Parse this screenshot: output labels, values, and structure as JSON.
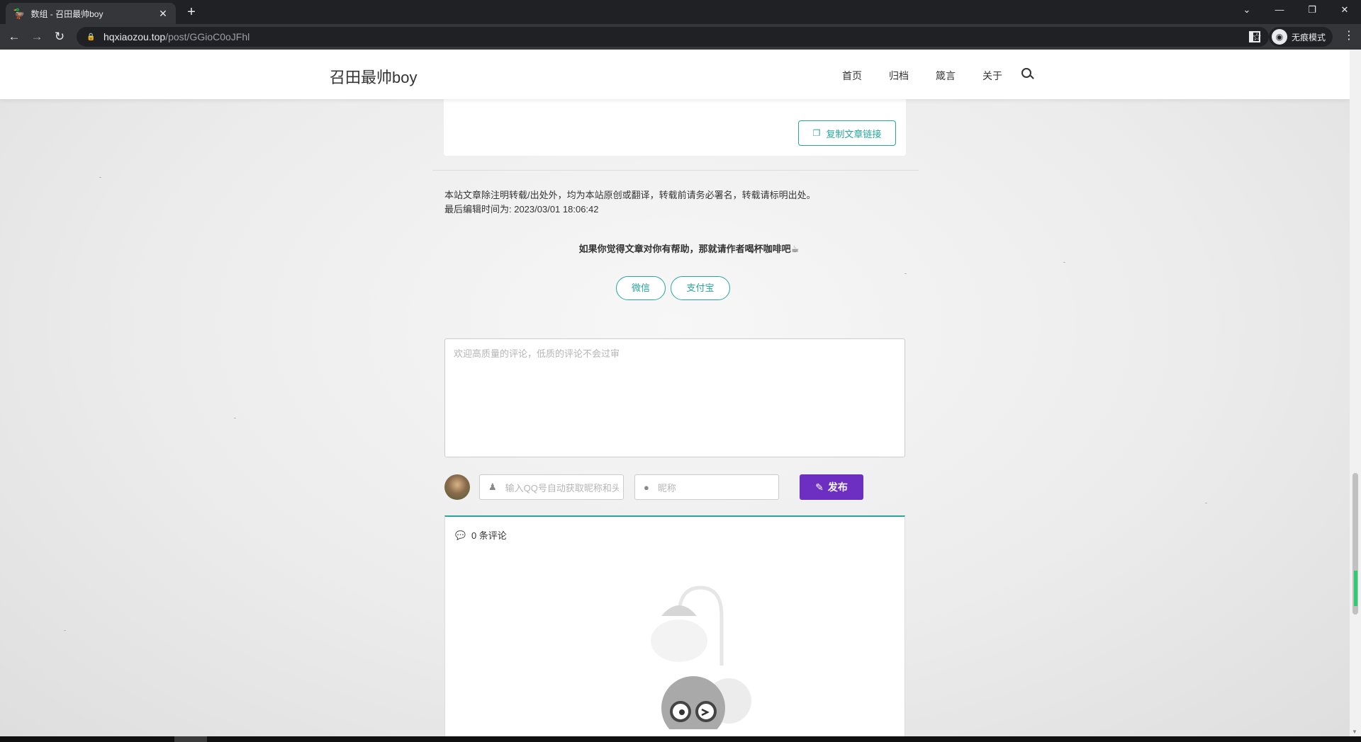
{
  "browser": {
    "tab_title": "数组 - 召田最帅boy",
    "tab_favicon": "🦆",
    "tab_close": "✕",
    "new_tab": "+",
    "url_host": "hqxiaozou.top",
    "url_path": "/post/GGioC0oJFhl",
    "incognito_label": "无痕模式",
    "window_controls": {
      "dropdown": "⌄",
      "minimize": "—",
      "restore": "❐",
      "close": "✕"
    }
  },
  "site": {
    "brand": "召田最帅boy",
    "nav": [
      "首页",
      "归档",
      "箴言",
      "关于"
    ]
  },
  "article": {
    "copy_link_label": "复制文章链接",
    "copyright_notice": "本站文章除注明转载/出处外，均为本站原创或翻译，转载前请务必署名，转载请标明出处。",
    "last_edited": "最后编辑时间为: 2023/03/01 18:06:42",
    "reward_prompt": "如果你觉得文章对你有帮助，那就请作者喝杯咖啡吧☕",
    "reward_buttons": {
      "wechat": "微信",
      "alipay": "支付宝"
    }
  },
  "comment_form": {
    "placeholder": "欢迎高质量的评论，低质的评论不会过审",
    "qq_placeholder": "输入QQ号自动获取昵称和头像",
    "nickname_placeholder": "昵称",
    "submit_label": "发布"
  },
  "comments": {
    "count_label": "0 条评论"
  },
  "colors": {
    "accent": "#26a69a",
    "submit": "#6c2fc2"
  }
}
